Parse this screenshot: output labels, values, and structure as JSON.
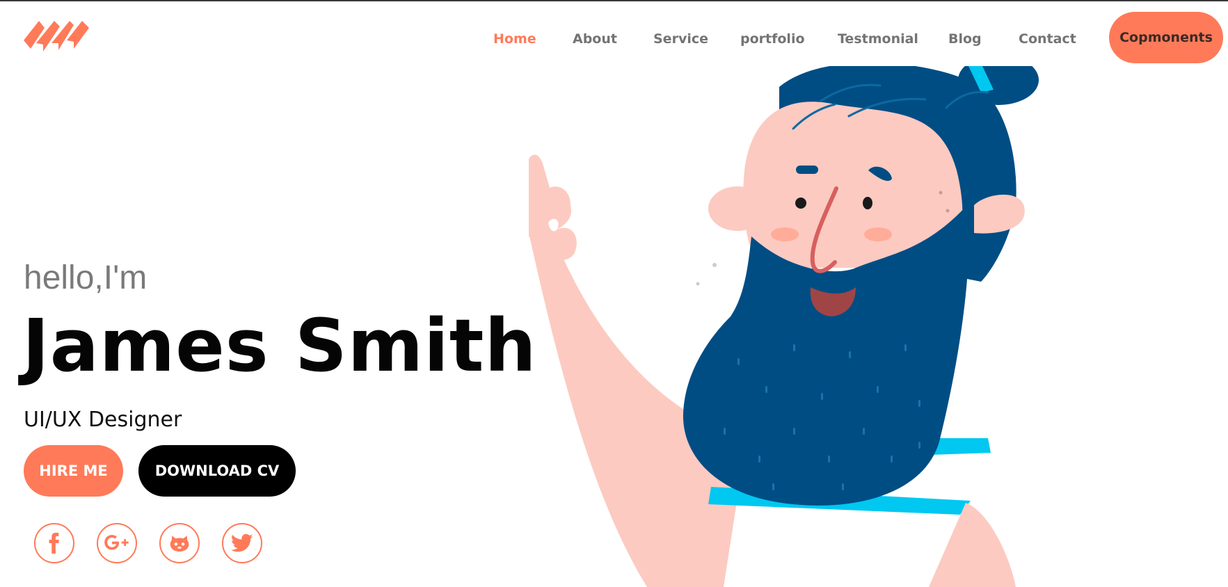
{
  "nav": {
    "items": [
      {
        "label": "Home",
        "active": true
      },
      {
        "label": "About",
        "active": false
      },
      {
        "label": "Service",
        "active": false
      },
      {
        "label": "portfolio",
        "active": false
      },
      {
        "label": "Testmonial",
        "active": false
      },
      {
        "label": "Blog",
        "active": false
      },
      {
        "label": "Contact",
        "active": false
      }
    ],
    "cta_label": "Copmonents"
  },
  "hero": {
    "greeting": "hello,I'm",
    "name": "James Smith",
    "role": "UI/UX Designer",
    "hire_label": "HIRE ME",
    "download_label": "DOWNLOAD CV"
  },
  "social": [
    {
      "icon": "facebook-icon"
    },
    {
      "icon": "google-plus-icon"
    },
    {
      "icon": "github-icon"
    },
    {
      "icon": "twitter-icon"
    }
  ],
  "colors": {
    "accent": "#ff7a59",
    "text_dark": "#050505",
    "nav_text": "#747474",
    "beard": "#004d84",
    "skin": "#fccac1",
    "stripe": "#00c8f0"
  }
}
